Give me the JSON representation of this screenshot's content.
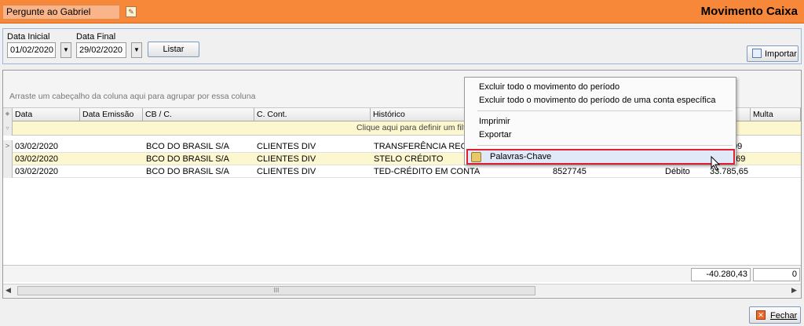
{
  "header": {
    "ask_placeholder": "Pergunte ao Gabriel",
    "ask_icon": "edit-icon",
    "title": "Movimento Caixa"
  },
  "filters": {
    "start_label": "Data Inicial",
    "start_value": "01/02/2020",
    "end_label": "Data Final",
    "end_value": "29/02/2020",
    "list_button": "Listar",
    "import_button": "Importar"
  },
  "grid": {
    "group_hint": "Arraste um cabeçalho da coluna aqui para agrupar por essa coluna",
    "filter_hint": "Clique aqui para definir um filtro",
    "columns": [
      "Data",
      "Data Emissão",
      "CB / C.",
      "C. Cont.",
      "Histórico",
      "Multa"
    ],
    "rows": [
      {
        "data": "03/02/2020",
        "emissao": "",
        "cb": "BCO DO BRASIL S/A",
        "cont": "CLIENTES DIV",
        "historico": "TRANSFERÊNCIA RECEB",
        "doc": "",
        "tipo": "",
        "valor": ",09"
      },
      {
        "data": "03/02/2020",
        "emissao": "",
        "cb": "BCO DO BRASIL S/A",
        "cont": "CLIENTES DIV",
        "historico": "STELO CRÉDITO",
        "doc": "",
        "tipo": "",
        "valor": "4,69"
      },
      {
        "data": "03/02/2020",
        "emissao": "",
        "cb": "BCO DO BRASIL S/A",
        "cont": "CLIENTES DIV",
        "historico": "TED-CRÉDITO EM CONTA",
        "doc": "8527745",
        "tipo": "Débito",
        "valor": "33.785,65"
      }
    ],
    "total": "-40.280,43",
    "total2": "0",
    "scroll_grip": "III"
  },
  "context_menu": {
    "items": [
      "Excluir todo o movimento do período",
      "Excluir todo o movimento do período de uma conta específica",
      "Imprimir",
      "Exportar",
      "Palavras-Chave"
    ]
  },
  "footer": {
    "close_button": "Fechar"
  },
  "colors": {
    "header_orange": "#f7883a",
    "selected_row": "#fdf7d0",
    "highlight_border": "#e02030"
  }
}
